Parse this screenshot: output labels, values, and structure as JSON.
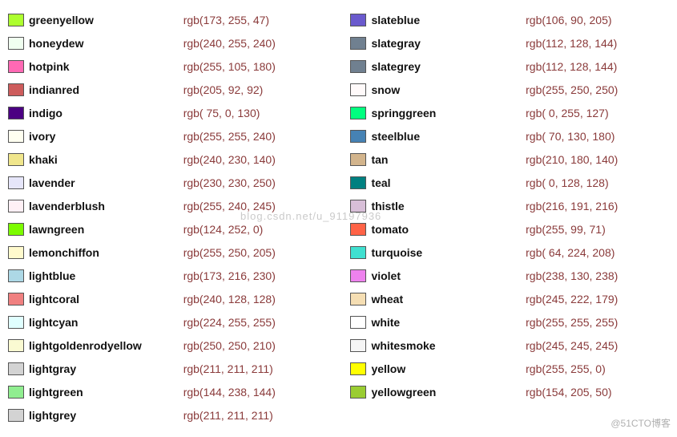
{
  "left": [
    {
      "name": "greenyellow",
      "swatch": "#ADFF2F",
      "rgb": "rgb(173, 255, 47)"
    },
    {
      "name": "honeydew",
      "swatch": "#F0FFF0",
      "rgb": "rgb(240, 255, 240)"
    },
    {
      "name": "hotpink",
      "swatch": "#FF69B4",
      "rgb": "rgb(255, 105, 180)"
    },
    {
      "name": "indianred",
      "swatch": "#CD5C5C",
      "rgb": "rgb(205, 92, 92)"
    },
    {
      "name": "indigo",
      "swatch": "#4B0082",
      "rgb": "rgb( 75, 0, 130)"
    },
    {
      "name": "ivory",
      "swatch": "#FFFFF0",
      "rgb": "rgb(255, 255, 240)"
    },
    {
      "name": "khaki",
      "swatch": "#F0E68C",
      "rgb": "rgb(240, 230, 140)"
    },
    {
      "name": "lavender",
      "swatch": "#E6E6FA",
      "rgb": "rgb(230, 230, 250)"
    },
    {
      "name": "lavenderblush",
      "swatch": "#FFF0F5",
      "rgb": "rgb(255, 240, 245)"
    },
    {
      "name": "lawngreen",
      "swatch": "#7CFC00",
      "rgb": "rgb(124, 252, 0)"
    },
    {
      "name": "lemonchiffon",
      "swatch": "#FFFACD",
      "rgb": "rgb(255, 250, 205)"
    },
    {
      "name": "lightblue",
      "swatch": "#ADD8E6",
      "rgb": "rgb(173, 216, 230)"
    },
    {
      "name": "lightcoral",
      "swatch": "#F08080",
      "rgb": "rgb(240, 128, 128)"
    },
    {
      "name": "lightcyan",
      "swatch": "#E0FFFF",
      "rgb": "rgb(224, 255, 255)"
    },
    {
      "name": "lightgoldenrodyellow",
      "swatch": "#FAFAD2",
      "rgb": "rgb(250, 250, 210)"
    },
    {
      "name": "lightgray",
      "swatch": "#D3D3D3",
      "rgb": "rgb(211, 211, 211)"
    },
    {
      "name": "lightgreen",
      "swatch": "#90EE90",
      "rgb": "rgb(144, 238, 144)"
    },
    {
      "name": "lightgrey",
      "swatch": "#D3D3D3",
      "rgb": "rgb(211, 211, 211)"
    }
  ],
  "right": [
    {
      "name": "slateblue",
      "swatch": "#6A5ACD",
      "rgb": "rgb(106, 90, 205)"
    },
    {
      "name": "slategray",
      "swatch": "#708090",
      "rgb": "rgb(112, 128, 144)"
    },
    {
      "name": "slategrey",
      "swatch": "#708090",
      "rgb": "rgb(112, 128, 144)"
    },
    {
      "name": "snow",
      "swatch": "#FFFAFA",
      "rgb": "rgb(255, 250, 250)"
    },
    {
      "name": "springgreen",
      "swatch": "#00FF7F",
      "rgb": "rgb( 0, 255, 127)"
    },
    {
      "name": "steelblue",
      "swatch": "#4682B4",
      "rgb": "rgb( 70, 130, 180)"
    },
    {
      "name": "tan",
      "swatch": "#D2B48C",
      "rgb": "rgb(210, 180, 140)"
    },
    {
      "name": "teal",
      "swatch": "#008080",
      "rgb": "rgb( 0, 128, 128)"
    },
    {
      "name": "thistle",
      "swatch": "#D8BFD8",
      "rgb": "rgb(216, 191, 216)"
    },
    {
      "name": "tomato",
      "swatch": "#FF6347",
      "rgb": "rgb(255, 99, 71)"
    },
    {
      "name": "turquoise",
      "swatch": "#40E0D0",
      "rgb": "rgb( 64, 224, 208)"
    },
    {
      "name": "violet",
      "swatch": "#EE82EE",
      "rgb": "rgb(238, 130, 238)"
    },
    {
      "name": "wheat",
      "swatch": "#F5DEB3",
      "rgb": "rgb(245, 222, 179)"
    },
    {
      "name": "white",
      "swatch": "#FFFFFF",
      "rgb": "rgb(255, 255, 255)"
    },
    {
      "name": "whitesmoke",
      "swatch": "#F5F5F5",
      "rgb": "rgb(245, 245, 245)"
    },
    {
      "name": "yellow",
      "swatch": "#FFFF00",
      "rgb": "rgb(255, 255, 0)"
    },
    {
      "name": "yellowgreen",
      "swatch": "#9ACD32",
      "rgb": "rgb(154, 205, 50)"
    }
  ],
  "watermark_center": "blog.csdn.net/u_91197936",
  "watermark_corner": "@51CTO博客"
}
